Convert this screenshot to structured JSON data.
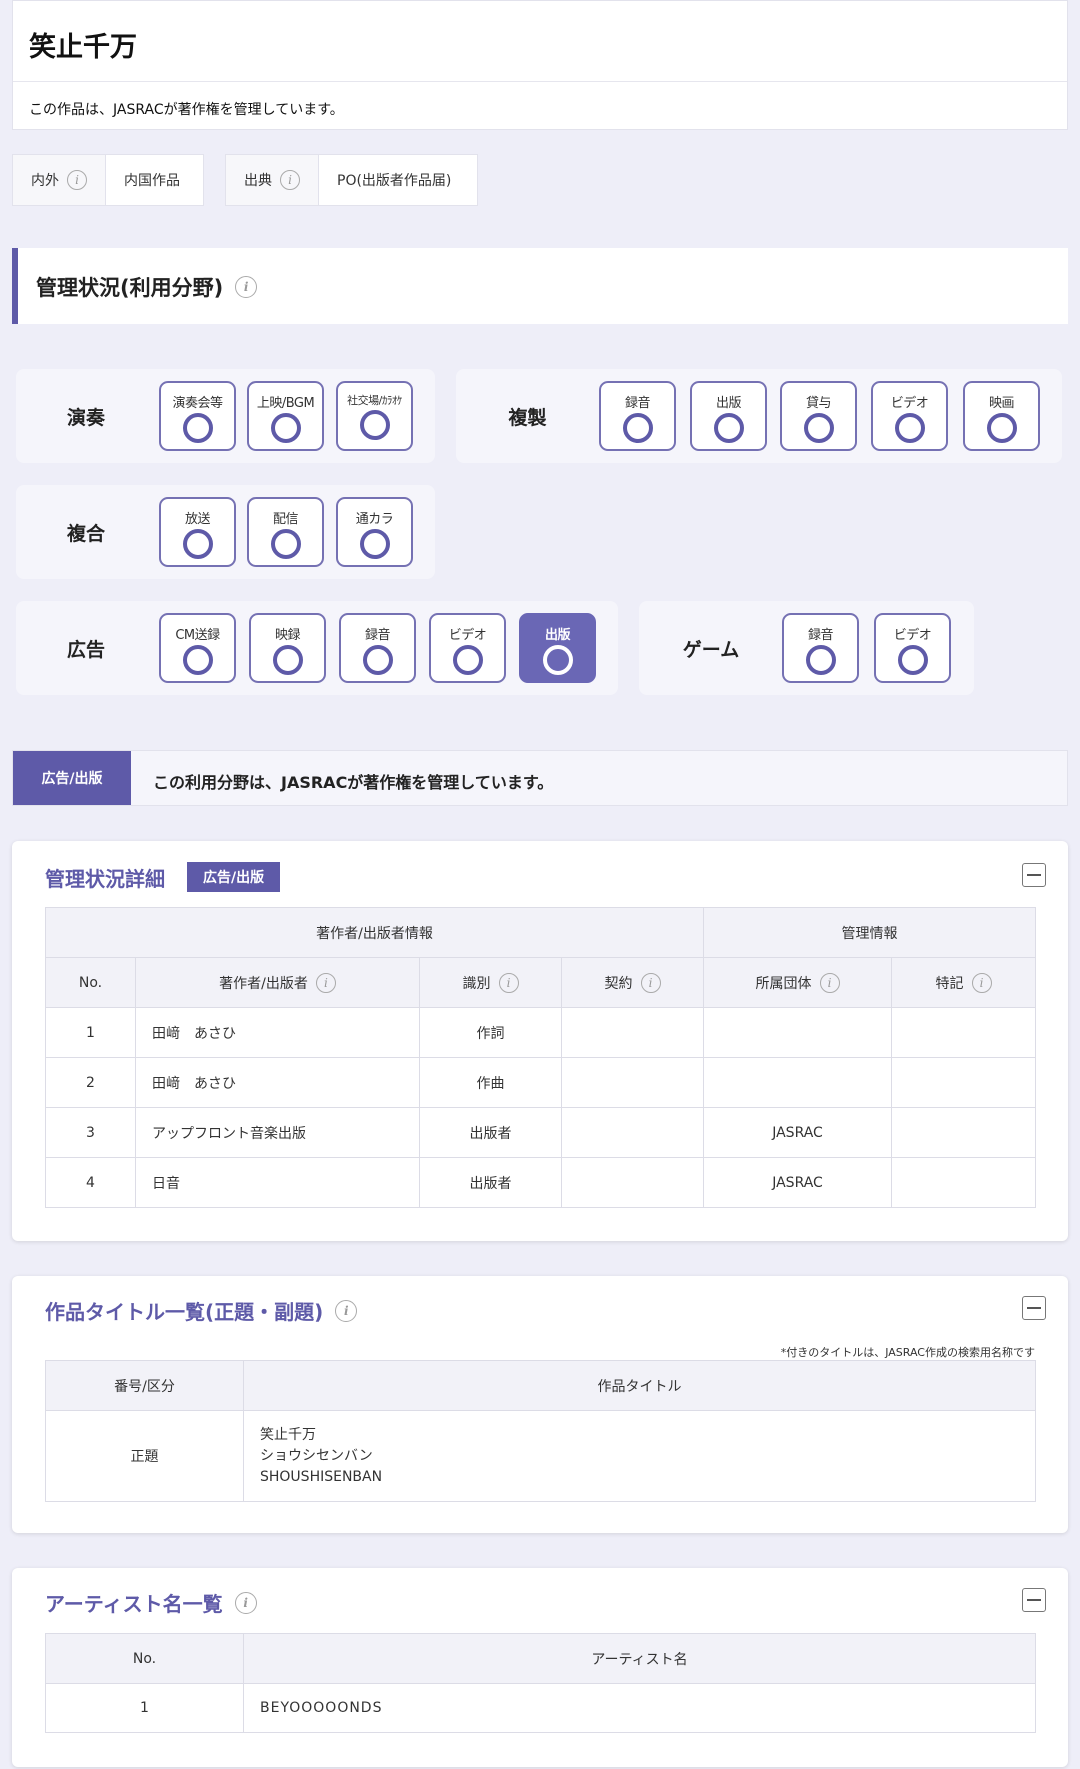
{
  "title": "笑止千万",
  "notice": "この作品は、JASRACが著作権を管理しています。",
  "meta": [
    {
      "label": "内外",
      "value": "内国作品"
    },
    {
      "label": "出典",
      "value": "PO(出版者作品届)"
    }
  ],
  "management": {
    "heading": "管理状況(利用分野)",
    "groups": {
      "ensou": {
        "label": "演奏",
        "items": [
          "演奏会等",
          "上映/BGM",
          "社交場/ｶﾗｵｹ"
        ]
      },
      "fukusei": {
        "label": "複製",
        "items": [
          "録音",
          "出版",
          "貸与",
          "ビデオ",
          "映画"
        ]
      },
      "fukugou": {
        "label": "複合",
        "items": [
          "放送",
          "配信",
          "通カラ"
        ]
      },
      "koukoku": {
        "label": "広告",
        "items": [
          "CM送録",
          "映録",
          "録音",
          "ビデオ",
          "出版"
        ]
      },
      "game": {
        "label": "ゲーム",
        "items": [
          "録音",
          "ビデオ"
        ]
      }
    },
    "selected": "広告/出版",
    "status_message": "この利用分野は、JASRACが著作権を管理しています。"
  },
  "detail": {
    "title": "管理状況詳細",
    "badge": "広告/出版",
    "group_headers": [
      "著作者/出版者情報",
      "管理情報"
    ],
    "columns": [
      "No.",
      "著作者/出版者",
      "識別",
      "契約",
      "所属団体",
      "特記"
    ],
    "rows": [
      {
        "no": "1",
        "name": "田﨑　あさひ",
        "type": "作詞",
        "contract": "",
        "org": "",
        "note": ""
      },
      {
        "no": "2",
        "name": "田﨑　あさひ",
        "type": "作曲",
        "contract": "",
        "org": "",
        "note": ""
      },
      {
        "no": "3",
        "name": "アップフロント音楽出版",
        "type": "出版者",
        "contract": "",
        "org": "JASRAC",
        "note": ""
      },
      {
        "no": "4",
        "name": "日音",
        "type": "出版者",
        "contract": "",
        "org": "JASRAC",
        "note": ""
      }
    ]
  },
  "titles": {
    "title": "作品タイトル一覧(正題・副題)",
    "footnote": "*付きのタイトルは、JASRAC作成の検索用名称です",
    "columns": [
      "番号/区分",
      "作品タイトル"
    ],
    "row": {
      "kind": "正題",
      "lines": [
        "笑止千万",
        "ショウシセンバン",
        "SHOUSHISENBAN"
      ]
    }
  },
  "artists": {
    "title": "アーティスト名一覧",
    "columns": [
      "No.",
      "アーティスト名"
    ],
    "rows": [
      {
        "no": "1",
        "name": "BEYOOOOONDS"
      }
    ]
  }
}
